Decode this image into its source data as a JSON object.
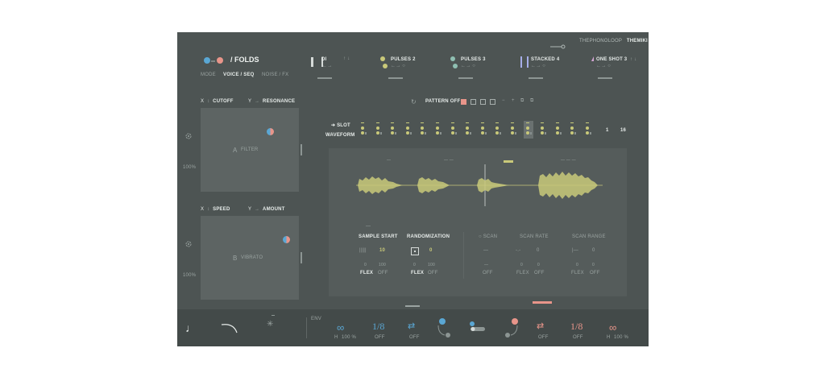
{
  "brand": {
    "the": "THE",
    "name": "PHONOLOOP",
    "sub": "THEMIKI"
  },
  "header": {
    "preset_title": "/ FOLDS"
  },
  "tabs": [
    {
      "label": "MODE",
      "active": false
    },
    {
      "label": "VOICE / SEQ",
      "active": true
    },
    {
      "label": "NOISE / FX",
      "active": false
    }
  ],
  "voices": [
    {
      "name": "DI",
      "color": "#d6dbd9"
    },
    {
      "name": "PULSES 2",
      "color": "#c9c97a"
    },
    {
      "name": "PULSES 3",
      "color": "#8fbfb2"
    },
    {
      "name": "STACKED 4",
      "color": "#a6aee8"
    },
    {
      "name": "ONE SHOT 3",
      "color": "#d6a6d6"
    }
  ],
  "pad_a": {
    "x_label": "X",
    "x_param": "CUTOFF",
    "y_label": "Y",
    "y_param": "RESONANCE",
    "letter": "A",
    "name": "FILTER",
    "amount": "100%"
  },
  "pad_b": {
    "x_label": "X",
    "x_param": "SPEED",
    "y_label": "Y",
    "y_param": "AMOUNT",
    "letter": "B",
    "name": "VIBRATO",
    "amount": "100%"
  },
  "pattern": {
    "label": "PATTERN OFF",
    "minus": "−",
    "plus": "+"
  },
  "sequencer": {
    "slot_label": "SLOT",
    "waveform_label": "WAVEFORM",
    "start": "1",
    "end": "16",
    "steps": 16,
    "active_step": 12
  },
  "sample": {
    "start": {
      "label": "SAMPLE START",
      "value": "10",
      "min": "0",
      "max": "100",
      "flex": "FLEX",
      "off": "OFF"
    },
    "random": {
      "label": "RANDOMIZATION",
      "value": "0",
      "min": "0",
      "max": "100",
      "flex": "FLEX",
      "off": "OFF"
    },
    "scan": {
      "label": "SCAN",
      "value": "—",
      "min": "—",
      "off": "OFF"
    },
    "scan_rate": {
      "label": "SCAN RATE",
      "value": "0",
      "min": "0",
      "max": "0",
      "flex": "FLEX",
      "off": "OFF"
    },
    "scan_range": {
      "label": "SCAN RANGE",
      "value": "0",
      "min": "0",
      "max": "0",
      "flex": "FLEX",
      "off": "OFF"
    }
  },
  "bottom": {
    "env": "ENV",
    "loop1": {
      "symbol": "∞",
      "h": "H",
      "pct": "100 %"
    },
    "rate1": {
      "value": "1/8",
      "off": "OFF"
    },
    "dir1": {
      "off": "OFF"
    },
    "dir2": {
      "off": "OFF"
    },
    "rate2": {
      "value": "1/8",
      "off": "OFF"
    },
    "loop2": {
      "symbol": "∞",
      "h": "H",
      "pct": "100 %"
    }
  },
  "colors": {
    "bg": "#4d5453",
    "pad": "#5d6463",
    "accent_blue": "#5aa7d4",
    "accent_coral": "#e8958a",
    "wave": "#c9c97a"
  }
}
